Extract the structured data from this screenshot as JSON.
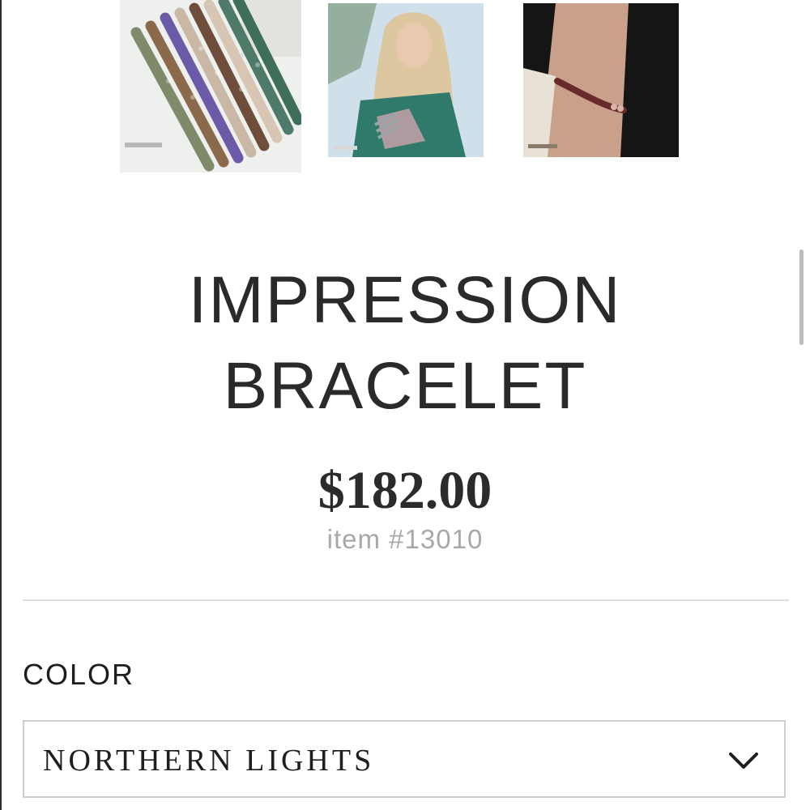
{
  "gallery": {
    "thumbnails": [
      {
        "icon": "bracelet-stack-image"
      },
      {
        "icon": "model-wearing-bracelets-image"
      },
      {
        "icon": "bracelet-on-wrist-image"
      }
    ]
  },
  "product": {
    "title_line_1": "IMPRESSION",
    "title_line_2": "BRACELET",
    "price": "$182.00",
    "item_number": "item #13010"
  },
  "options": {
    "color_label": "COLOR",
    "color_selected": "NORTHERN LIGHTS",
    "dropdown_icon": "chevron-down-icon"
  },
  "colors": {
    "text": "#2a2a2a",
    "muted": "#a8a8a8",
    "divider": "#dcdce2",
    "border": "#cfcfcf"
  }
}
